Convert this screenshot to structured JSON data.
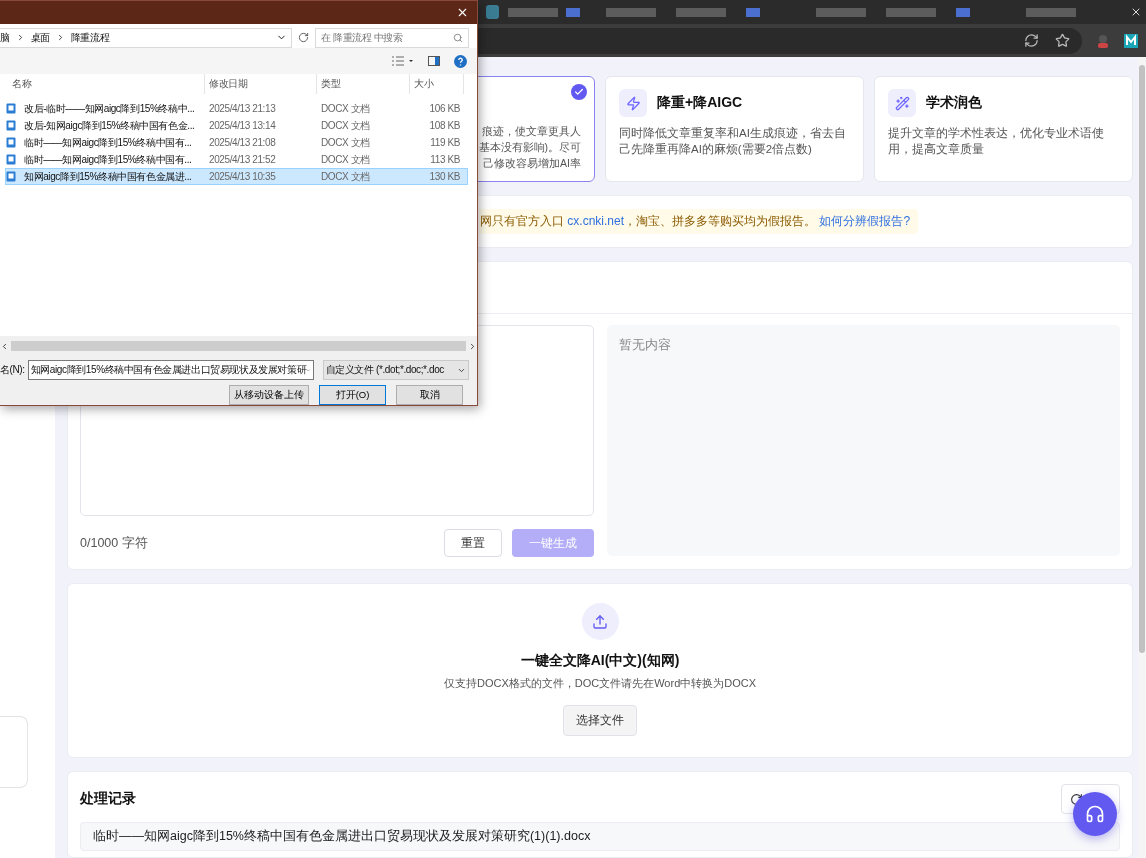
{
  "dialog": {
    "breadcrumb": [
      "脑",
      "桌面",
      "降重流程"
    ],
    "search_placeholder": "在 降重流程 中搜索",
    "columns": [
      "名称",
      "修改日期",
      "类型",
      "大小"
    ],
    "files": [
      {
        "name": "改后-临时——知网aigc降到15%终稿中...",
        "date": "2025/4/13 21:13",
        "type": "DOCX 文档",
        "size": "106 KB",
        "selected": false
      },
      {
        "name": "改后-知网aigc降到15%终稿中国有色金...",
        "date": "2025/4/13 13:14",
        "type": "DOCX 文档",
        "size": "108 KB",
        "selected": false
      },
      {
        "name": "临时——知网aigc降到15%终稿中国有...",
        "date": "2025/4/13 21:08",
        "type": "DOCX 文档",
        "size": "119 KB",
        "selected": false
      },
      {
        "name": "临时——知网aigc降到15%终稿中国有...",
        "date": "2025/4/13 21:52",
        "type": "DOCX 文档",
        "size": "113 KB",
        "selected": false
      },
      {
        "name": "知网aigc降到15%终稿中国有色金属进...",
        "date": "2025/4/13 10:35",
        "type": "DOCX 文档",
        "size": "130 KB",
        "selected": true
      }
    ],
    "filename_label": "名(N):",
    "filename_value": "知网aigc降到15%终稿中国有色金属进出口贸易现状及发展对策研",
    "filetype": "自定义文件 (*.dot;*.doc;*.doc",
    "buttons": [
      {
        "label": "从移动设备上传",
        "focused": false
      },
      {
        "label": "打开(O)",
        "focused": true
      },
      {
        "label": "取消",
        "focused": false
      }
    ]
  },
  "modes": [
    {
      "visible_lines": [
        "痕迹，使文章更具人",
        "基本没有影响)。尽可",
        "己修改容易增加AI率"
      ],
      "selected": true
    },
    {
      "title": "降重+降AIGC",
      "description": "同时降低文章重复率和AI生成痕迹，省去自己先降重再降AI的麻烦(需要2倍点数)",
      "selected": false
    },
    {
      "title": "学术润色",
      "description": "提升文章的学术性表达，优化专业术语使用，提高文章质量",
      "selected": false
    }
  ],
  "notice": {
    "text_before": "网只有官方入口 ",
    "link": "cx.cnki.net",
    "text_after": "，淘宝、拼多多等购买均为假报告。",
    "help_link": "如何分辨假报告?"
  },
  "editor": {
    "counter": "0/1000 字符",
    "output_placeholder": "暂无内容",
    "reset": "重置",
    "generate": {
      "label": "一键生成",
      "disabled": true
    }
  },
  "upload": {
    "title": "一键全文降AI(中文)(知网)",
    "hint": "仅支持DOCX格式的文件，DOC文件请先在Word中转换为DOCX",
    "button": "选择文件"
  },
  "records": {
    "title": "处理记录",
    "items": [
      "临时——知网aigc降到15%终稿中国有色金属进出口贸易现状及发展对策研究(1)(1).docx"
    ]
  }
}
